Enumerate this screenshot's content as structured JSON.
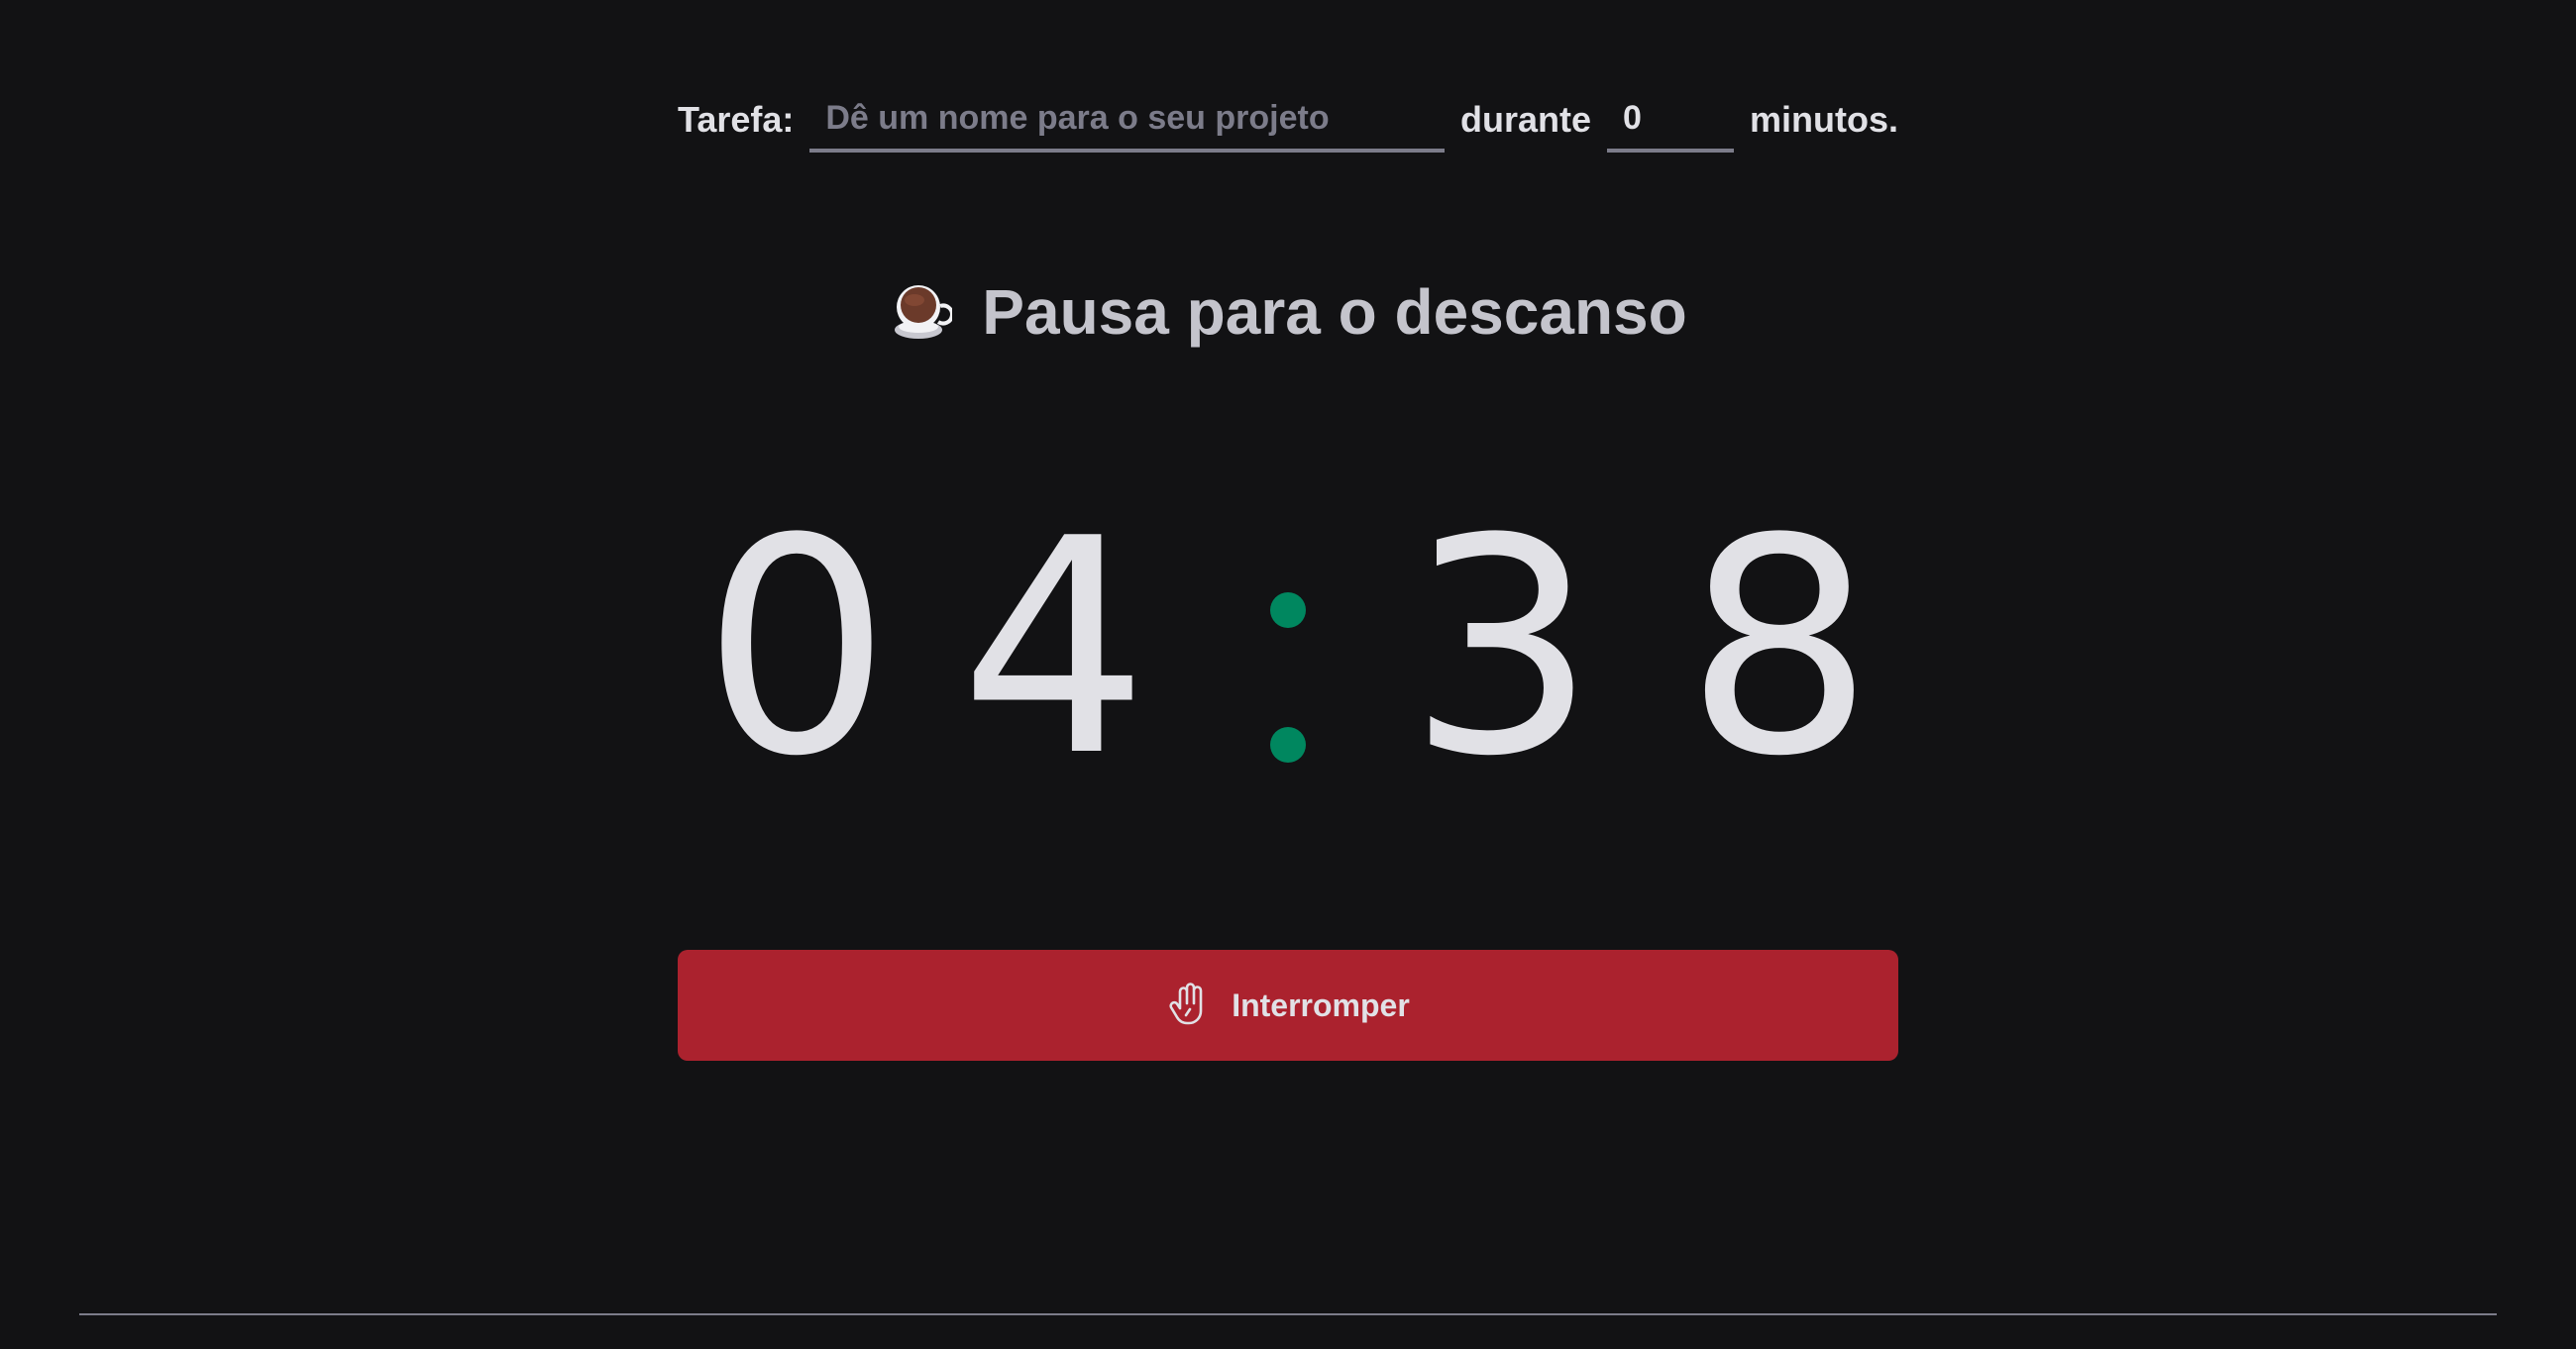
{
  "task_form": {
    "task_label": "Tarefa:",
    "task_placeholder": "Dê um nome para o seu projeto",
    "task_value": "",
    "during_label": "durante",
    "minutes_value": "0",
    "minutes_label": "minutos."
  },
  "cycle": {
    "icon": "coffee-cup-icon",
    "status_text": "Pausa para o descanso"
  },
  "countdown": {
    "minutes": [
      "0",
      "4"
    ],
    "seconds": [
      "3",
      "8"
    ],
    "separator_color": "#00875f"
  },
  "stop_button": {
    "icon": "hand-palm-icon",
    "label": "Interromper",
    "color": "#ab222e"
  },
  "theme": {
    "background": "#121214",
    "text": "#e1e1e6",
    "muted": "#7c7c8a"
  }
}
